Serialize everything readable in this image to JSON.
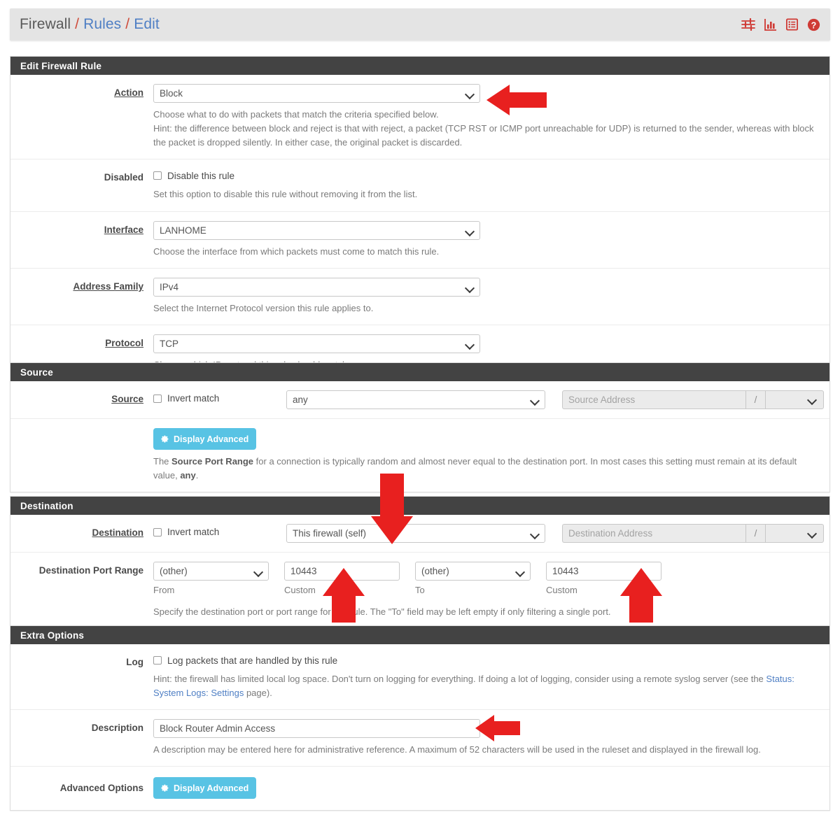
{
  "header": {
    "breadcrumb": [
      "Firewall",
      "Rules",
      "Edit"
    ],
    "separator": "/",
    "icons": [
      "sliders-icon",
      "chart-icon",
      "list-icon",
      "help-icon"
    ],
    "icon_color": "#cf3a35",
    "link_color": "#4f7fc4"
  },
  "sections": {
    "edit_rule": {
      "title": "Edit Firewall Rule",
      "action": {
        "label": "Action",
        "value": "Block",
        "hint_line1": "Choose what to do with packets that match the criteria specified below.",
        "hint_line2": "Hint: the difference between block and reject is that with reject, a packet (TCP RST or ICMP port unreachable for UDP) is returned to the sender, whereas with block the packet is dropped silently. In either case, the original packet is discarded."
      },
      "disabled": {
        "label": "Disabled",
        "checkbox_label": "Disable this rule",
        "checked": false,
        "hint": "Set this option to disable this rule without removing it from the list."
      },
      "interface": {
        "label": "Interface",
        "value": "LANHOME",
        "hint": "Choose the interface from which packets must come to match this rule."
      },
      "address_family": {
        "label": "Address Family",
        "value": "IPv4",
        "hint": "Select the Internet Protocol version this rule applies to."
      },
      "protocol": {
        "label": "Protocol",
        "value": "TCP",
        "hint": "Choose which IP protocol this rule should match."
      }
    },
    "source": {
      "title": "Source",
      "row": {
        "label": "Source",
        "invert_label": "Invert match",
        "invert_checked": false,
        "type_value": "any",
        "address_placeholder": "Source Address",
        "slash": "/",
        "mask_value": ""
      },
      "advanced_button": "Display Advanced",
      "hint_pre": "The ",
      "hint_bold1": "Source Port Range",
      "hint_mid": " for a connection is typically random and almost never equal to the destination port. In most cases this setting must remain at its default value, ",
      "hint_bold2": "any",
      "hint_post": "."
    },
    "destination": {
      "title": "Destination",
      "row": {
        "label": "Destination",
        "invert_label": "Invert match",
        "invert_checked": false,
        "type_value": "This firewall (self)",
        "address_placeholder": "Destination Address",
        "slash": "/",
        "mask_value": ""
      },
      "port_range": {
        "label": "Destination Port Range",
        "from_select": "(other)",
        "from_caption": "From",
        "from_custom": "10443",
        "from_custom_caption": "Custom",
        "to_select": "(other)",
        "to_caption": "To",
        "to_custom": "10443",
        "to_custom_caption": "Custom",
        "hint": "Specify the destination port or port range for this rule. The \"To\" field may be left empty if only filtering a single port."
      }
    },
    "extra_options": {
      "title": "Extra Options",
      "log": {
        "label": "Log",
        "checkbox_label": "Log packets that are handled by this rule",
        "checked": false,
        "hint_pre": "Hint: the firewall has limited local log space. Don't turn on logging for everything. If doing a lot of logging, consider using a remote syslog server (see the ",
        "hint_link": "Status: System Logs: Settings",
        "hint_post": " page)."
      },
      "description": {
        "label": "Description",
        "value": "Block Router Admin Access",
        "hint": "A description may be entered here for administrative reference. A maximum of 52 characters will be used in the ruleset and displayed in the firewall log."
      },
      "advanced_options": {
        "label": "Advanced Options",
        "button": "Display Advanced"
      }
    }
  },
  "annotations": {
    "arrow_color": "#e8201f",
    "arrows": [
      {
        "name": "arrow-action-select",
        "direction": "left"
      },
      {
        "name": "arrow-destination-type-select",
        "direction": "down"
      },
      {
        "name": "arrow-port-from-custom",
        "direction": "up"
      },
      {
        "name": "arrow-port-to-custom",
        "direction": "up"
      },
      {
        "name": "arrow-description-field",
        "direction": "left"
      }
    ]
  }
}
